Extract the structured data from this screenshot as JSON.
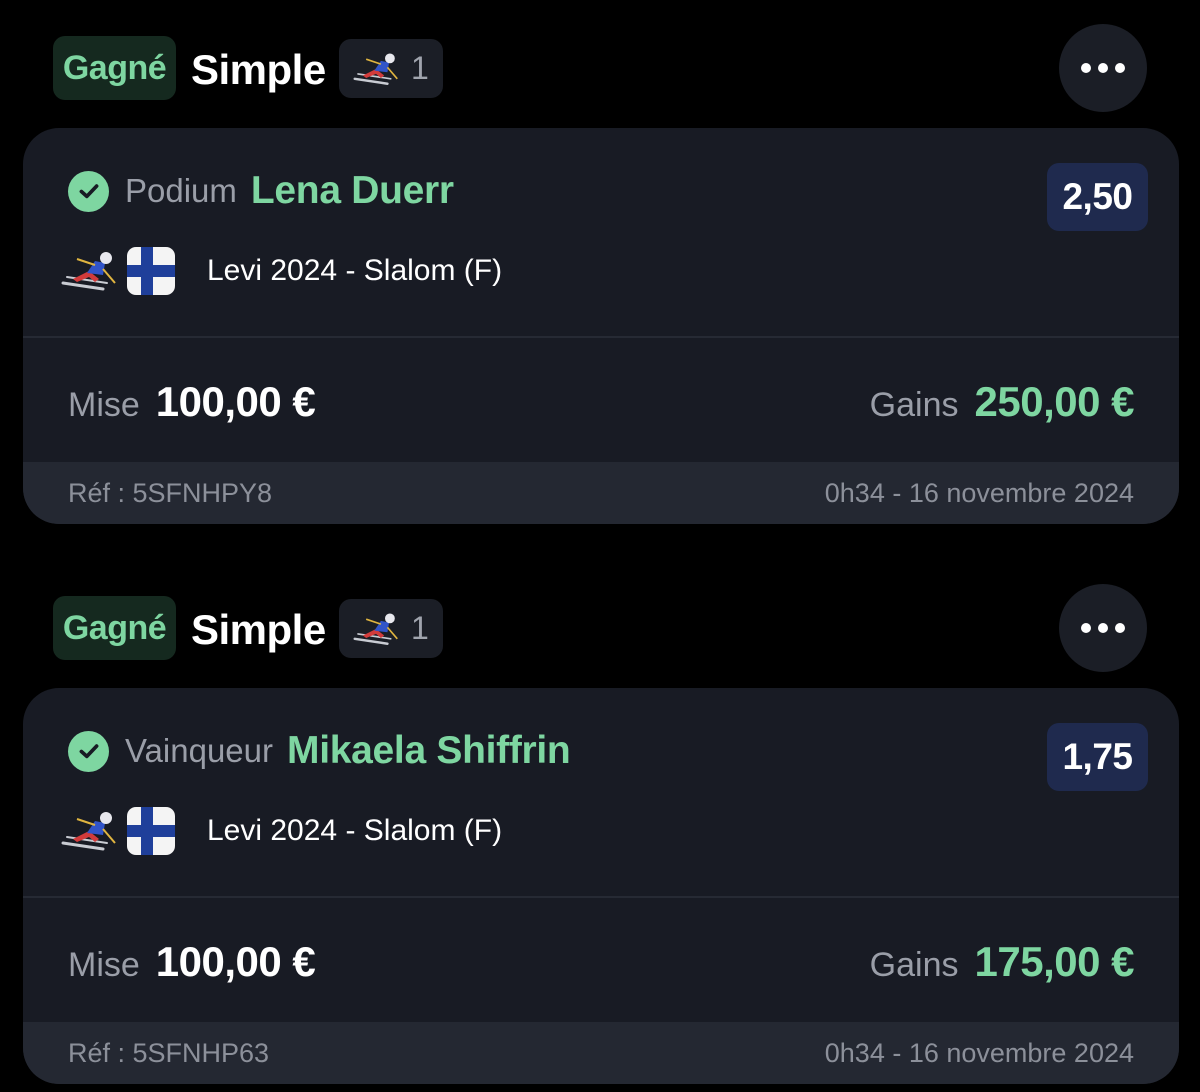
{
  "bets": [
    {
      "status": "Gagné",
      "type": "Simple",
      "sport_icon": "alpine-skier-icon",
      "selections_count": "1",
      "market": "Podium",
      "selection": "Lena Duerr",
      "odds": "2,50",
      "flag_icon": "finland-flag-icon",
      "event": "Levi 2024 - Slalom (F)",
      "stake_label": "Mise",
      "stake": "100,00 €",
      "gains_label": "Gains",
      "gains": "250,00 €",
      "ref": "Réf : 5SFNHPY8",
      "date": "0h34 - 16 novembre 2024"
    },
    {
      "status": "Gagné",
      "type": "Simple",
      "sport_icon": "alpine-skier-icon",
      "selections_count": "1",
      "market": "Vainqueur",
      "selection": "Mikaela Shiffrin",
      "odds": "1,75",
      "flag_icon": "finland-flag-icon",
      "event": "Levi 2024 - Slalom (F)",
      "stake_label": "Mise",
      "stake": "100,00 €",
      "gains_label": "Gains",
      "gains": "175,00 €",
      "ref": "Réf : 5SFNHP63",
      "date": "0h34 - 16 novembre 2024"
    }
  ],
  "colors": {
    "background": "#000000",
    "card": "#181b24",
    "accent_green": "#7ed6a1",
    "odds_bg": "#1f2a4e",
    "muted_text": "#9a9ea8"
  }
}
